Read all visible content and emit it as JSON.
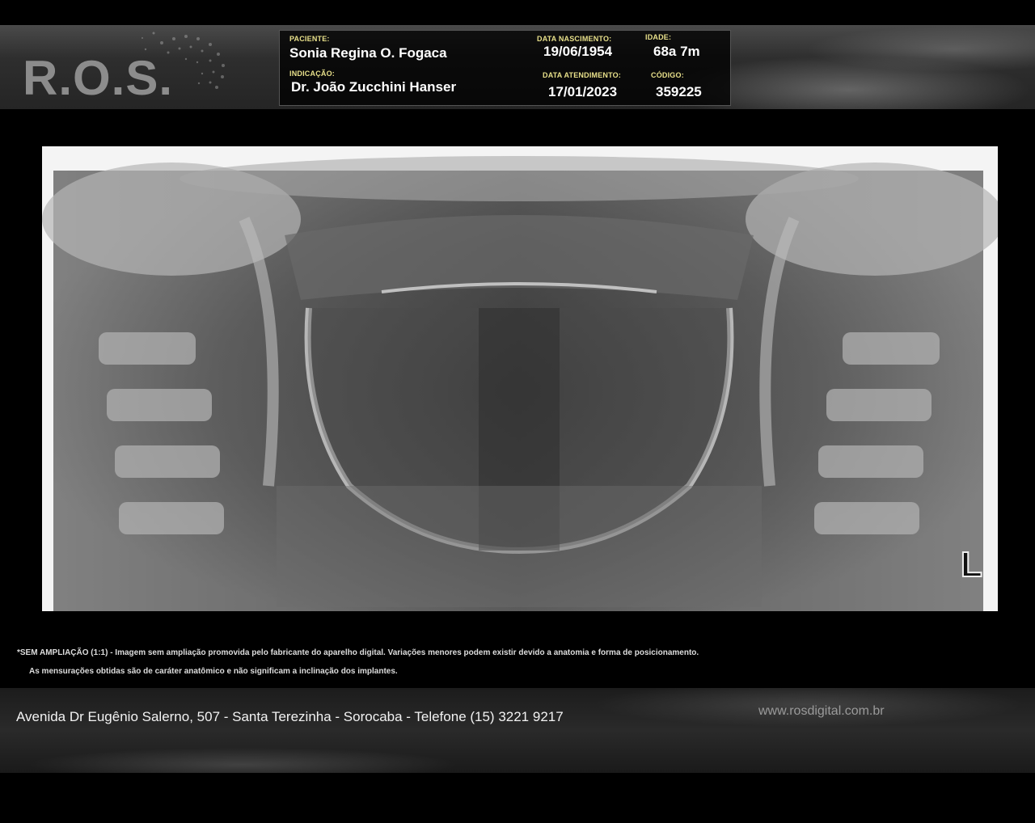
{
  "header": {
    "logo_text": "R.O.S.",
    "patient_label": "PACIENTE:",
    "patient_name": "Sonia Regina O. Fogaca",
    "indication_label": "INDICAÇÃO:",
    "indication_value": "Dr. João Zucchini Hanser",
    "birth_label": "DATA NASCIMENTO:",
    "birth_value": "19/06/1954",
    "age_label": "IDADE:",
    "age_value": "68a 7m",
    "visit_label": "DATA ATENDIMENTO:",
    "visit_value": "17/01/2023",
    "code_label": "CÓDIGO:",
    "code_value": "359225"
  },
  "image": {
    "side_marker": "L"
  },
  "notes": {
    "line1": "*SEM AMPLIAÇÃO (1:1) - Imagem sem ampliação promovida pelo fabricante do aparelho digital. Variações menores podem existir devido a anatomia e forma de posicionamento.",
    "line2": "As mensurações obtidas são de caráter anatômico e não significam a inclinação dos implantes."
  },
  "footer": {
    "address": "Avenida  Dr Eugênio Salerno, 507 - Santa Terezinha - Sorocaba  -  Telefone (15) 3221 9217",
    "website": "www.rosdigital.com.br"
  }
}
